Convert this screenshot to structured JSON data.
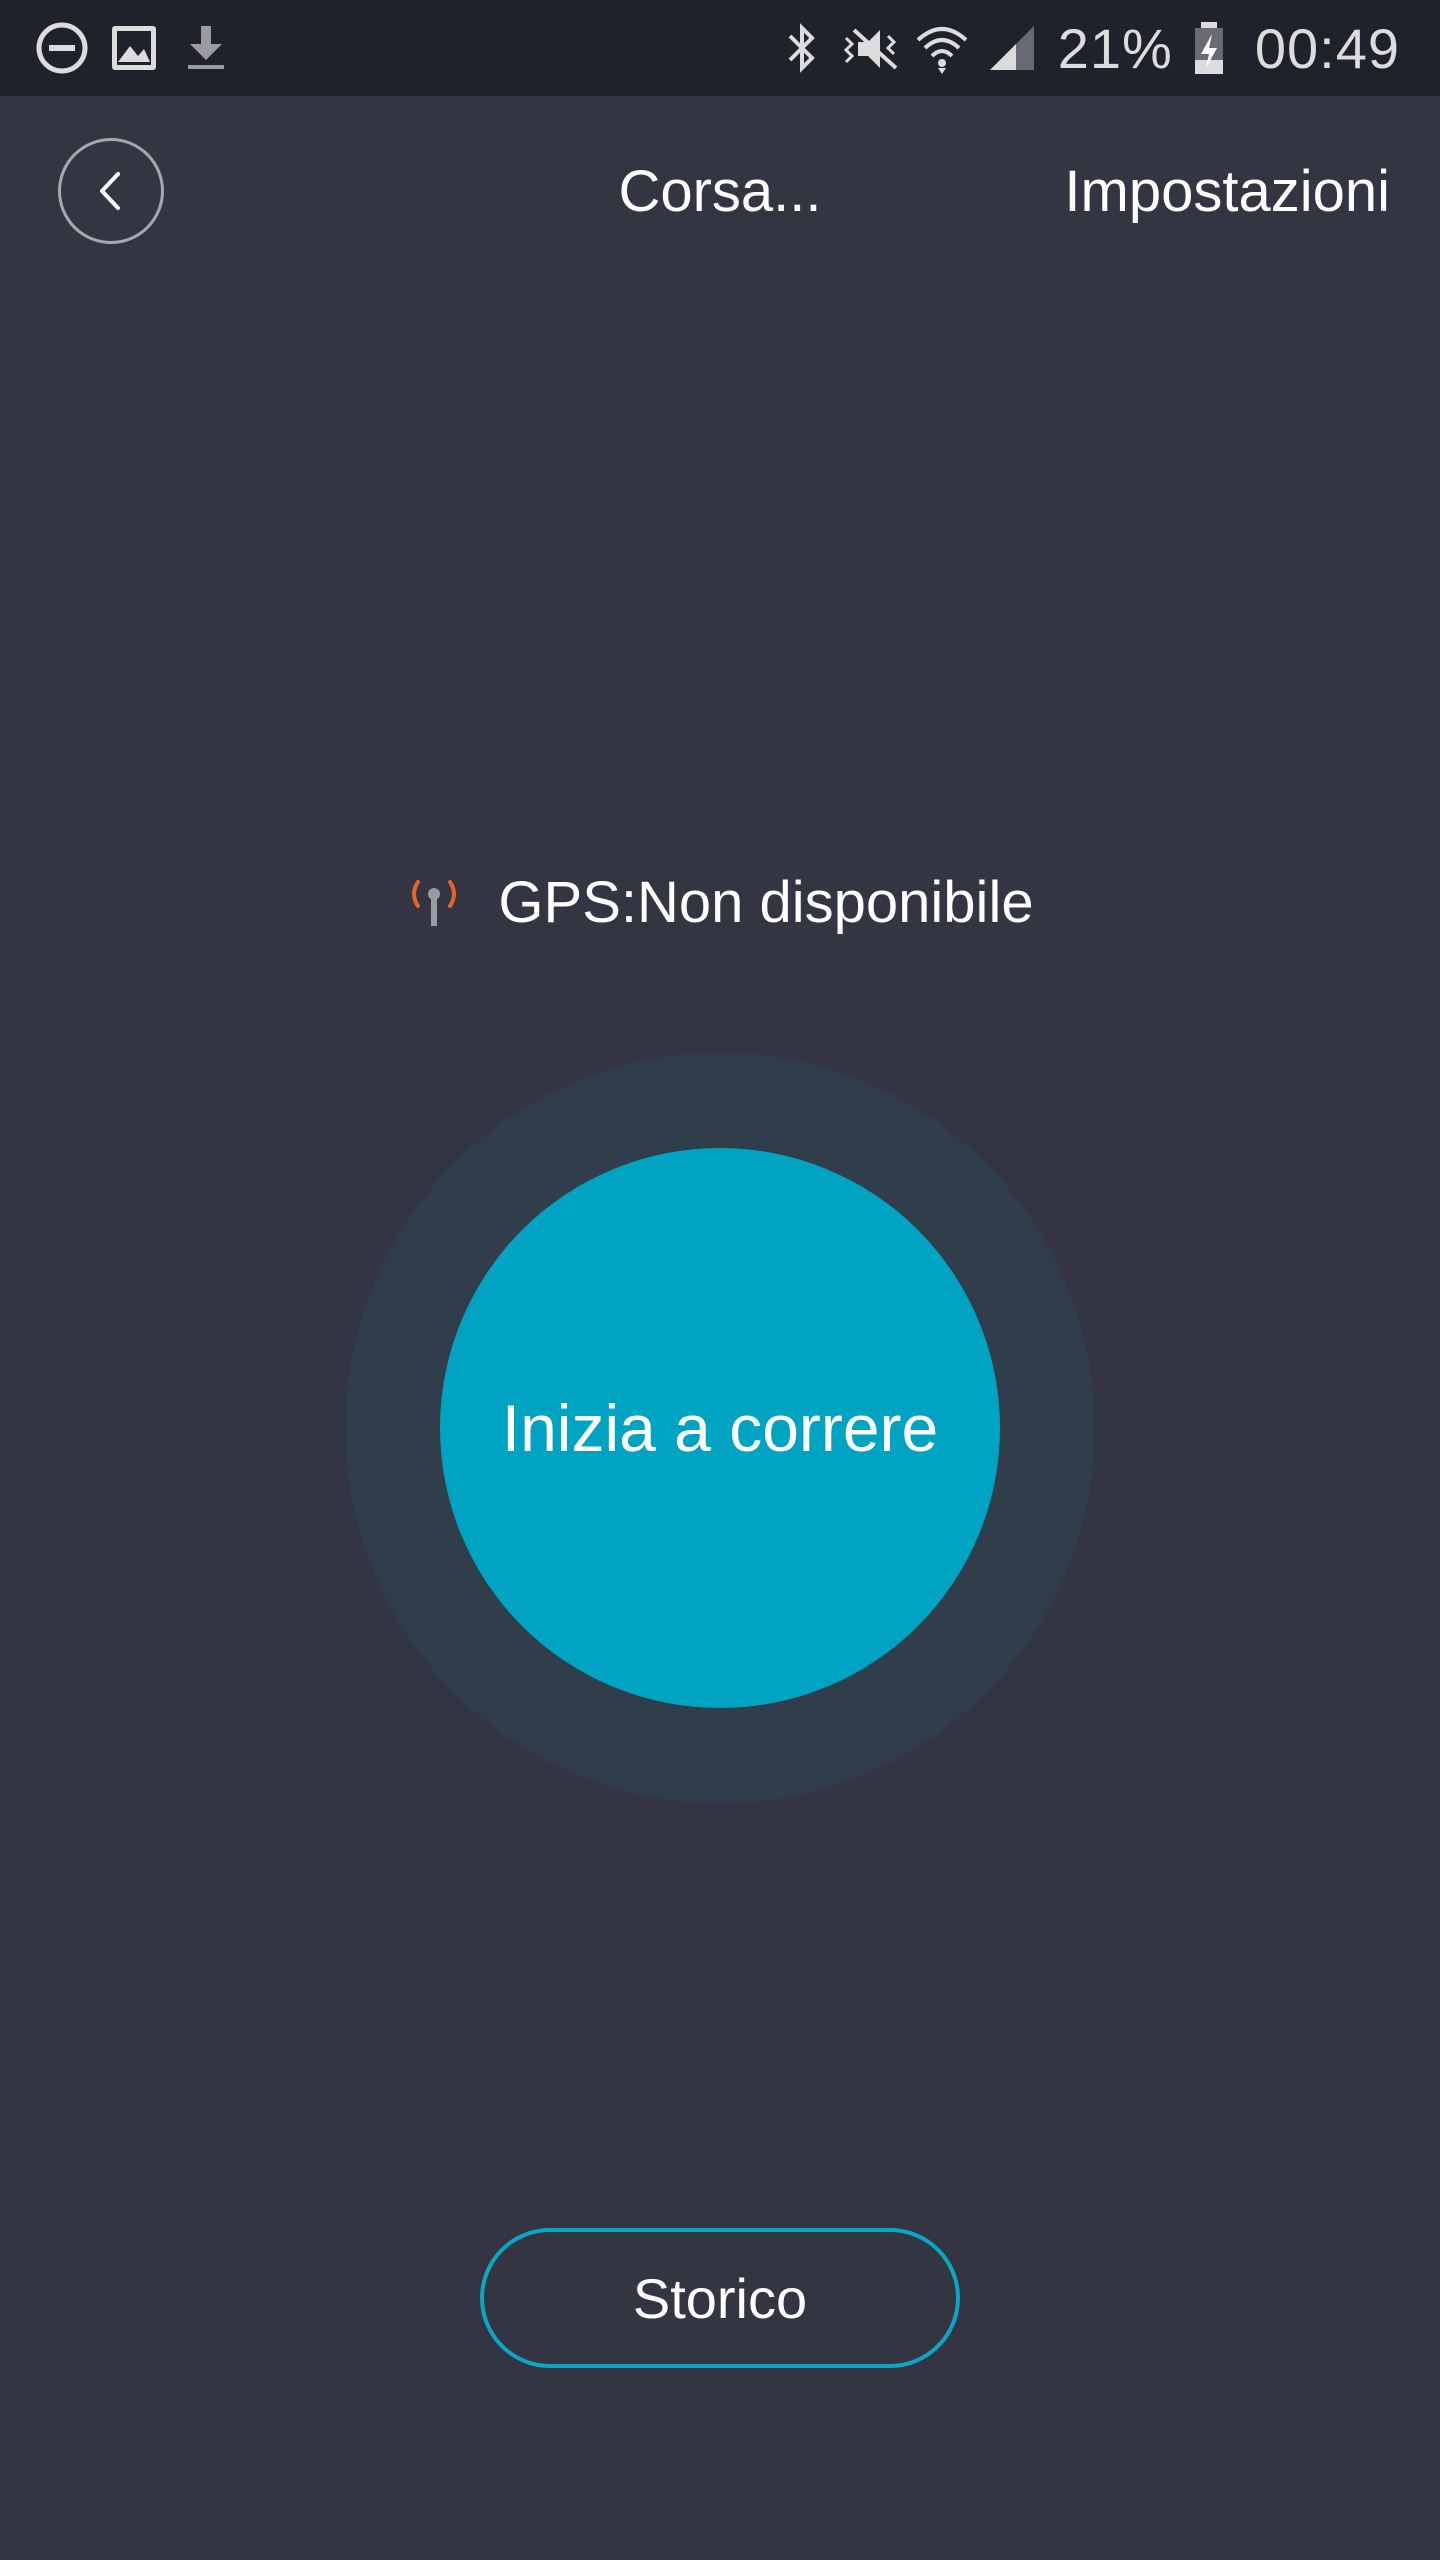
{
  "status_bar": {
    "left_icons": [
      "do-not-disturb-icon",
      "image-icon",
      "download-icon"
    ],
    "right_icons": [
      "bluetooth-icon",
      "mute-vibrate-icon",
      "wifi-icon",
      "signal-icon"
    ],
    "battery_percent": "21%",
    "battery_icon": "battery-charging-icon",
    "time": "00:49"
  },
  "header": {
    "back_icon": "chevron-left-icon",
    "title": "Corsa...",
    "settings_label": "Impostazioni"
  },
  "gps": {
    "icon": "gps-antenna-icon",
    "status_text": "GPS:Non disponibile",
    "icon_color": "#e8622c"
  },
  "main": {
    "start_label": "Inizia a correre",
    "accent_color": "#00a3c2"
  },
  "footer": {
    "history_label": "Storico"
  }
}
